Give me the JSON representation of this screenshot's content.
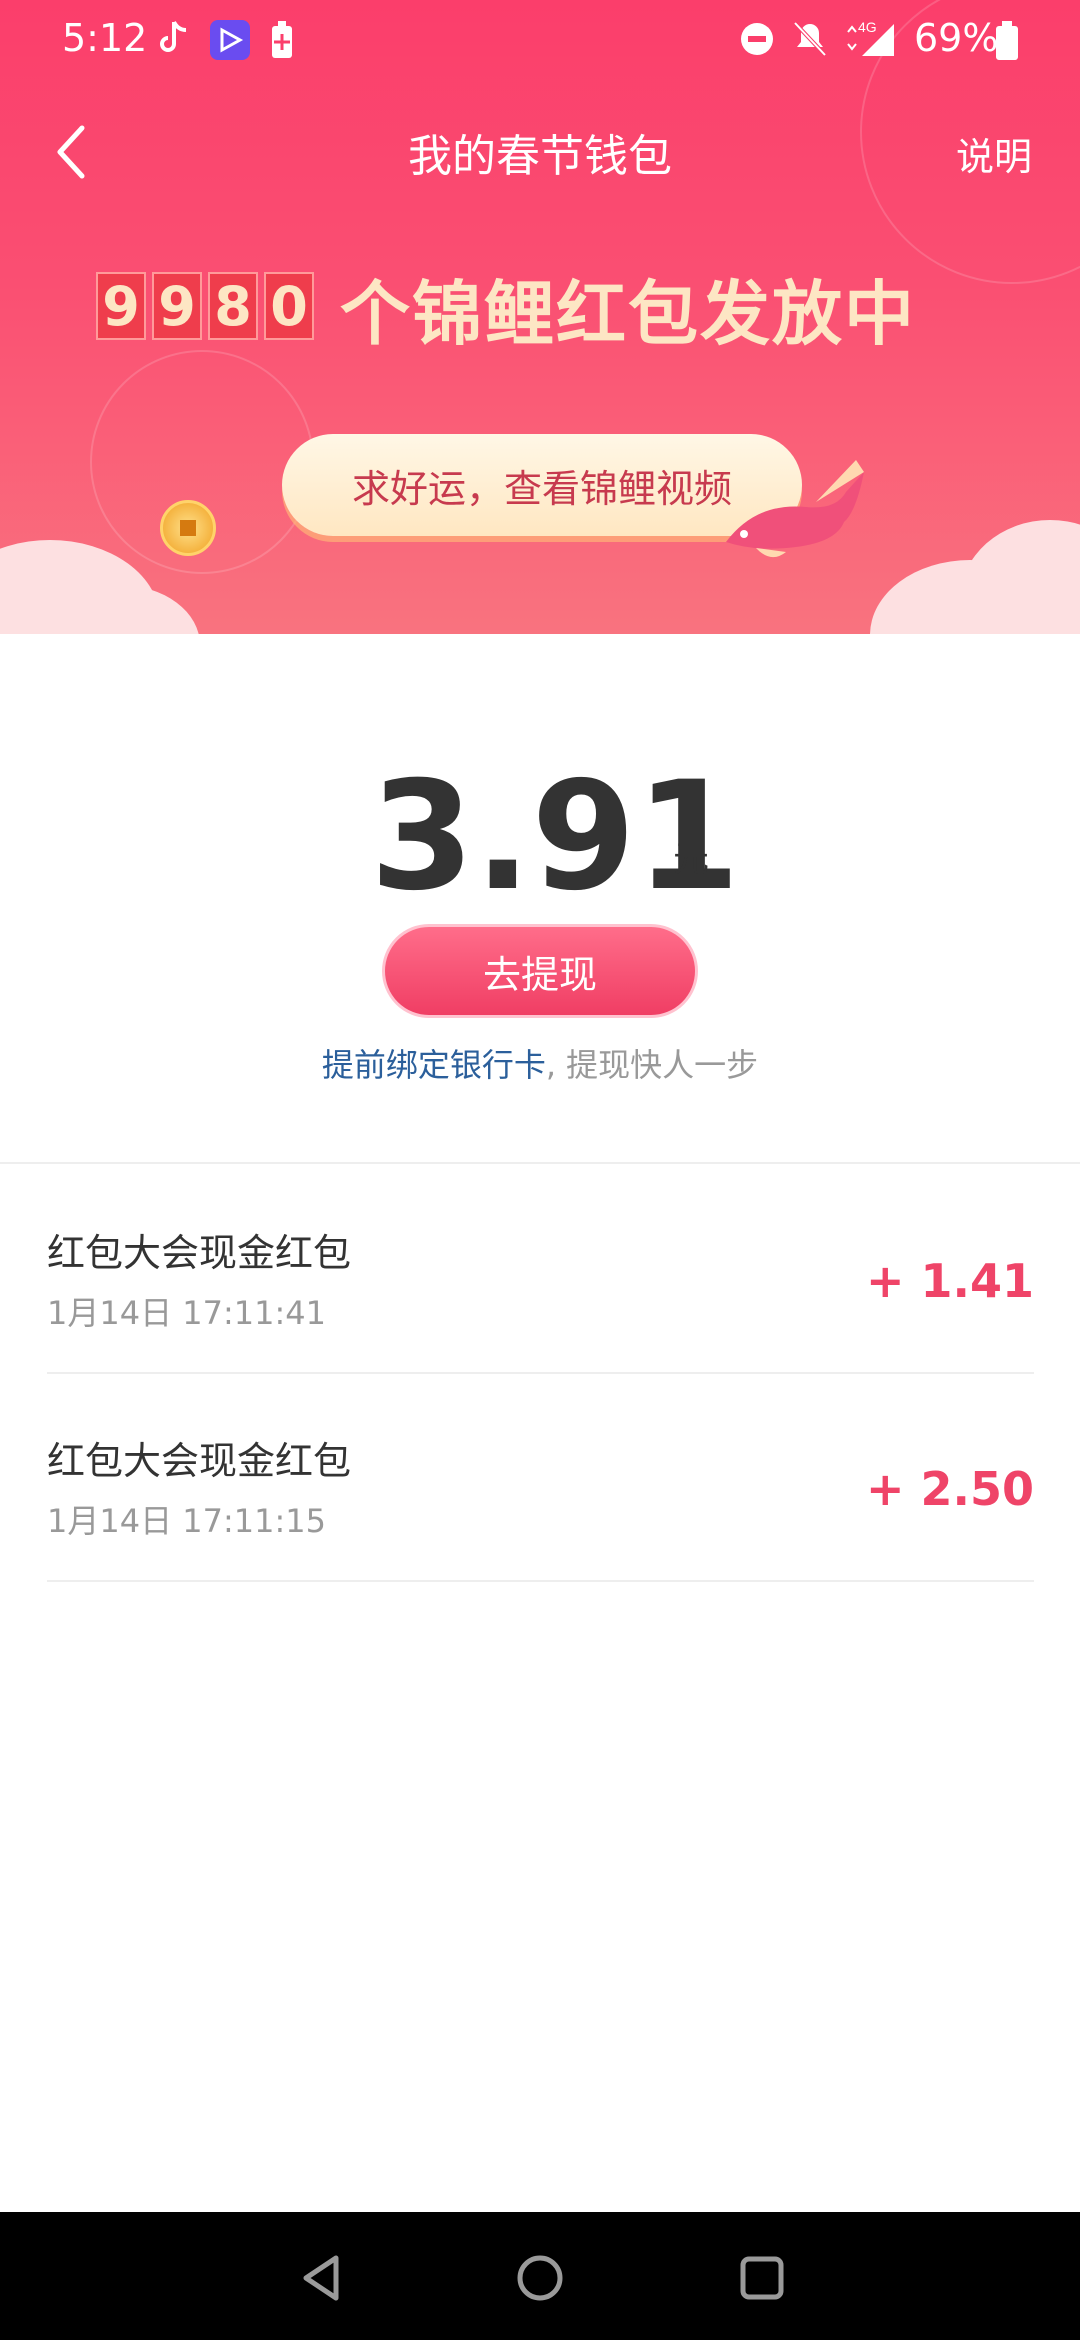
{
  "status_bar": {
    "time": "5:12",
    "battery_percent": "69%",
    "network": "4G"
  },
  "nav": {
    "title": "我的春节钱包",
    "explain_label": "说明"
  },
  "banner": {
    "counter_digits": [
      "9",
      "9",
      "8",
      "0"
    ],
    "counter_text": "个锦鲤红包发放中",
    "koi_button_label": "求好运，查看锦鲤视频"
  },
  "balance": {
    "amount": "3.91",
    "unit": "元",
    "withdraw_label": "去提现",
    "bind_link": "提前绑定银行卡",
    "bind_rest": ", 提现快人一步"
  },
  "records": [
    {
      "title": "红包大会现金红包",
      "time": "1月14日 17:11:41",
      "amount": "+ 1.41"
    },
    {
      "title": "红包大会现金红包",
      "time": "1月14日 17:11:15",
      "amount": "+ 2.50"
    }
  ],
  "colors": {
    "header": "#fb3e6b",
    "accent": "#ef4468",
    "link": "#2b5f9b",
    "gold_text": "#fde6c4"
  }
}
